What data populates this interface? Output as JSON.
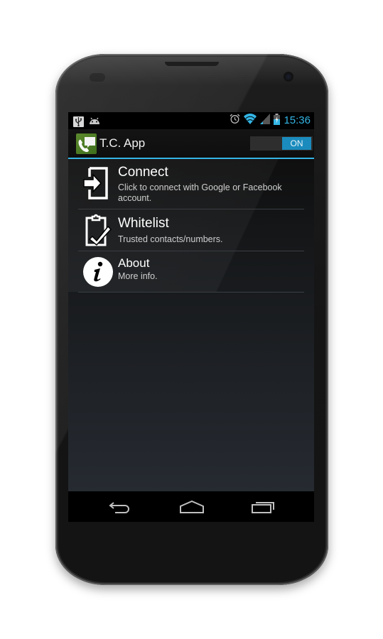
{
  "status_bar": {
    "left_icons": [
      "usb-icon",
      "android-debug-icon"
    ],
    "right_icons": [
      "alarm-icon",
      "wifi-icon",
      "signal-icon",
      "battery-charging-icon"
    ],
    "time": "15:36"
  },
  "action_bar": {
    "app_icon": "phone-chat-icon",
    "title": "T.C. App",
    "toggle_label": "ON",
    "toggle_state": true
  },
  "colors": {
    "accent": "#33b5e5",
    "toggle_on": "#1b8bbd",
    "app_icon_green": "#4f7d25"
  },
  "menu": {
    "items": [
      {
        "icon": "sign-in-icon",
        "title": "Connect",
        "subtitle": "Click to connect with Google or Facebook account."
      },
      {
        "icon": "clipboard-check-icon",
        "title": "Whitelist",
        "subtitle": "Trusted contacts/numbers."
      },
      {
        "icon": "info-icon",
        "title": "About",
        "subtitle": "More info."
      }
    ]
  },
  "nav_bar": {
    "buttons": [
      "back-icon",
      "home-icon",
      "recent-apps-icon"
    ]
  }
}
